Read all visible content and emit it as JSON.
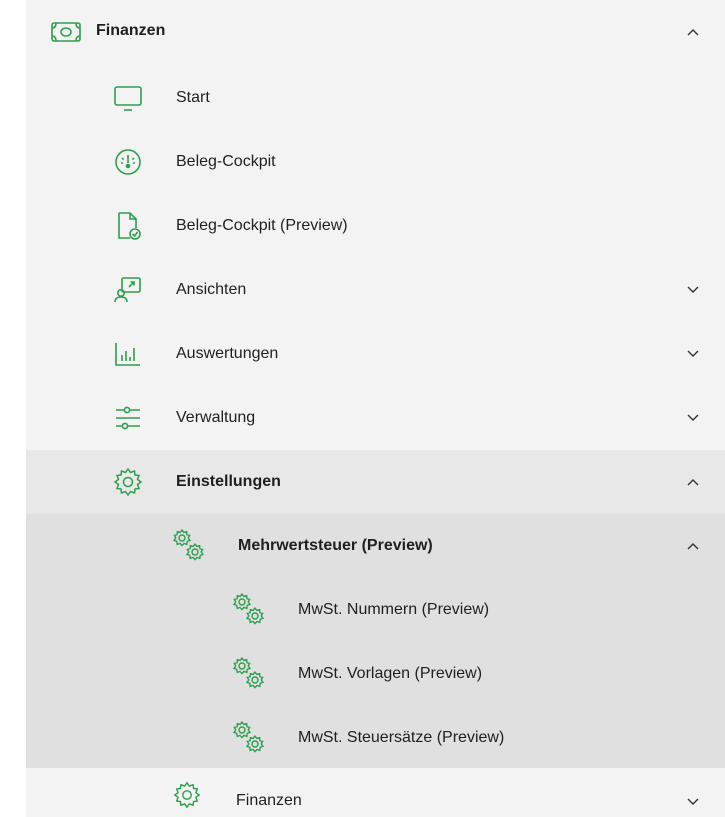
{
  "nav": {
    "top": {
      "label": "Finanzen",
      "icon": "money-icon",
      "expanded": true
    },
    "items": [
      {
        "label": "Start",
        "icon": "monitor-icon"
      },
      {
        "label": "Beleg-Cockpit",
        "icon": "gauge-icon"
      },
      {
        "label": "Beleg-Cockpit (Preview)",
        "icon": "document-check-icon"
      },
      {
        "label": "Ansichten",
        "icon": "user-view-icon",
        "expandable": true,
        "expanded": false
      },
      {
        "label": "Auswertungen",
        "icon": "bar-chart-icon",
        "expandable": true,
        "expanded": false
      },
      {
        "label": "Verwaltung",
        "icon": "sliders-icon",
        "expandable": true,
        "expanded": false
      },
      {
        "label": "Einstellungen",
        "icon": "gear-icon",
        "expandable": true,
        "expanded": true
      }
    ],
    "settings": {
      "group": {
        "label": "Mehrwertsteuer (Preview)",
        "icon": "gears-icon",
        "expanded": true
      },
      "children": [
        {
          "label": "MwSt. Nummern (Preview)",
          "icon": "gears-icon"
        },
        {
          "label": "MwSt. Vorlagen (Preview)",
          "icon": "gears-icon"
        },
        {
          "label": "MwSt. Steuersätze (Preview)",
          "icon": "gears-icon"
        }
      ],
      "last": {
        "label": "Finanzen",
        "icon": "gear-icon",
        "expanded": false
      }
    }
  },
  "colors": {
    "accent": "#2e9e4f",
    "text": "#1f1f1f",
    "background": "#f3f3f3"
  }
}
